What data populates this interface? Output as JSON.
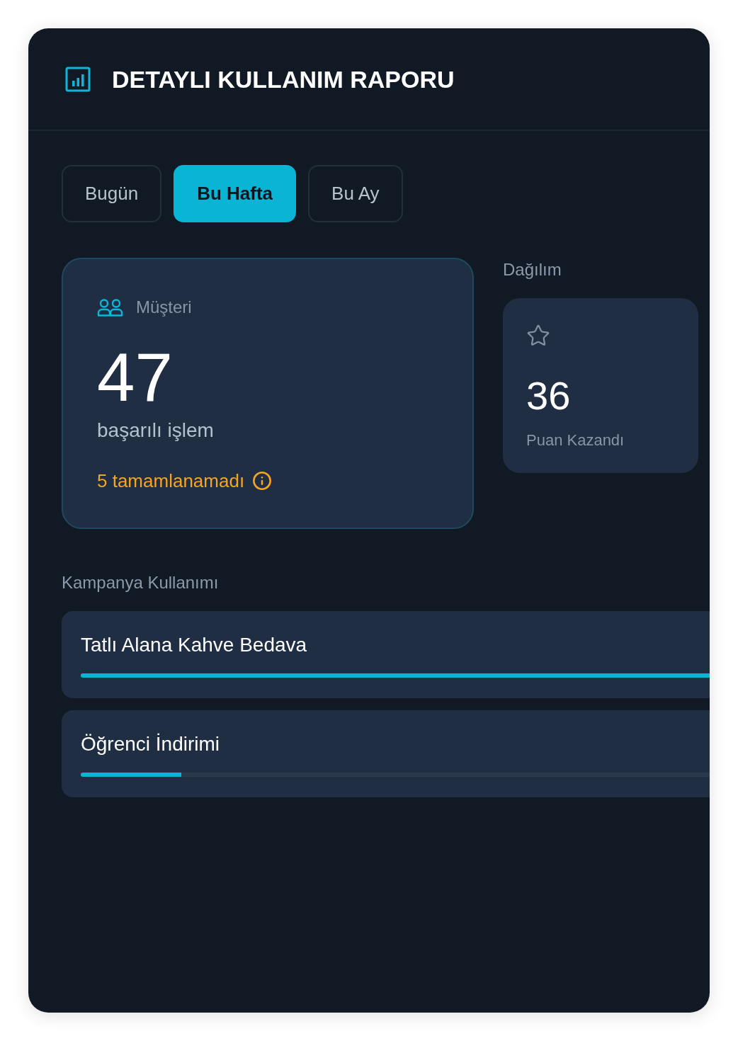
{
  "header": {
    "title": "DETAYLI KULLANIM RAPORU"
  },
  "tabs": [
    {
      "label": "Bugün",
      "selected": false
    },
    {
      "label": "Bu Hafta",
      "selected": true
    },
    {
      "label": "Bu Ay",
      "selected": false
    }
  ],
  "customer_card": {
    "label": "Müşteri",
    "value": "47",
    "caption": "başarılı işlem",
    "warning": "5 tamamlanamadı"
  },
  "distribution": {
    "heading": "Dağılım",
    "cards": [
      {
        "value": "36",
        "label": "Puan Kazandı"
      }
    ]
  },
  "campaigns": {
    "heading": "Kampanya Kullanımı",
    "items": [
      {
        "name": "Tatlı Alana Kahve Bedava",
        "level": 1
      },
      {
        "name": "Öğrenci İndirimi",
        "level": 0.16
      }
    ]
  }
}
